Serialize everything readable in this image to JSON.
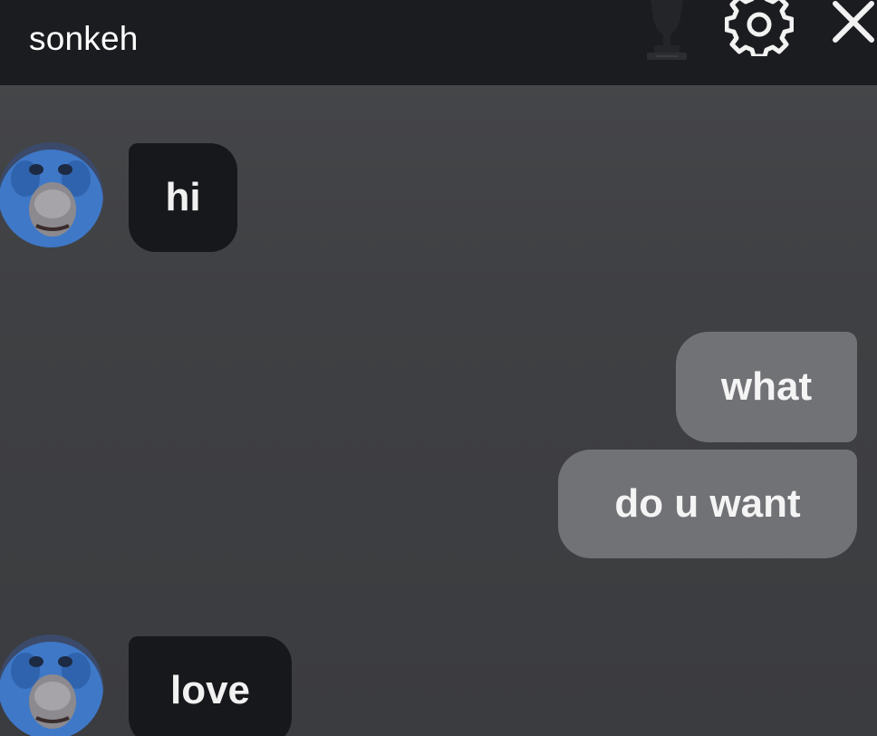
{
  "header": {
    "title": "sonkeh",
    "icons": [
      "trophy-icon",
      "gear-icon",
      "close-icon"
    ]
  },
  "messages": [
    {
      "direction": "incoming",
      "text": "hi",
      "avatar": "blue-creature-avatar"
    },
    {
      "direction": "outgoing",
      "text": "what"
    },
    {
      "direction": "outgoing",
      "text": "do u want"
    },
    {
      "direction": "incoming",
      "text": "love",
      "avatar": "blue-creature-avatar"
    }
  ],
  "colors": {
    "header_bg": "#1b1c1f",
    "chat_bg": "#3e3f42",
    "incoming_bubble": "#17181b",
    "outgoing_bubble": "#717276",
    "text": "#f1f1f1"
  }
}
